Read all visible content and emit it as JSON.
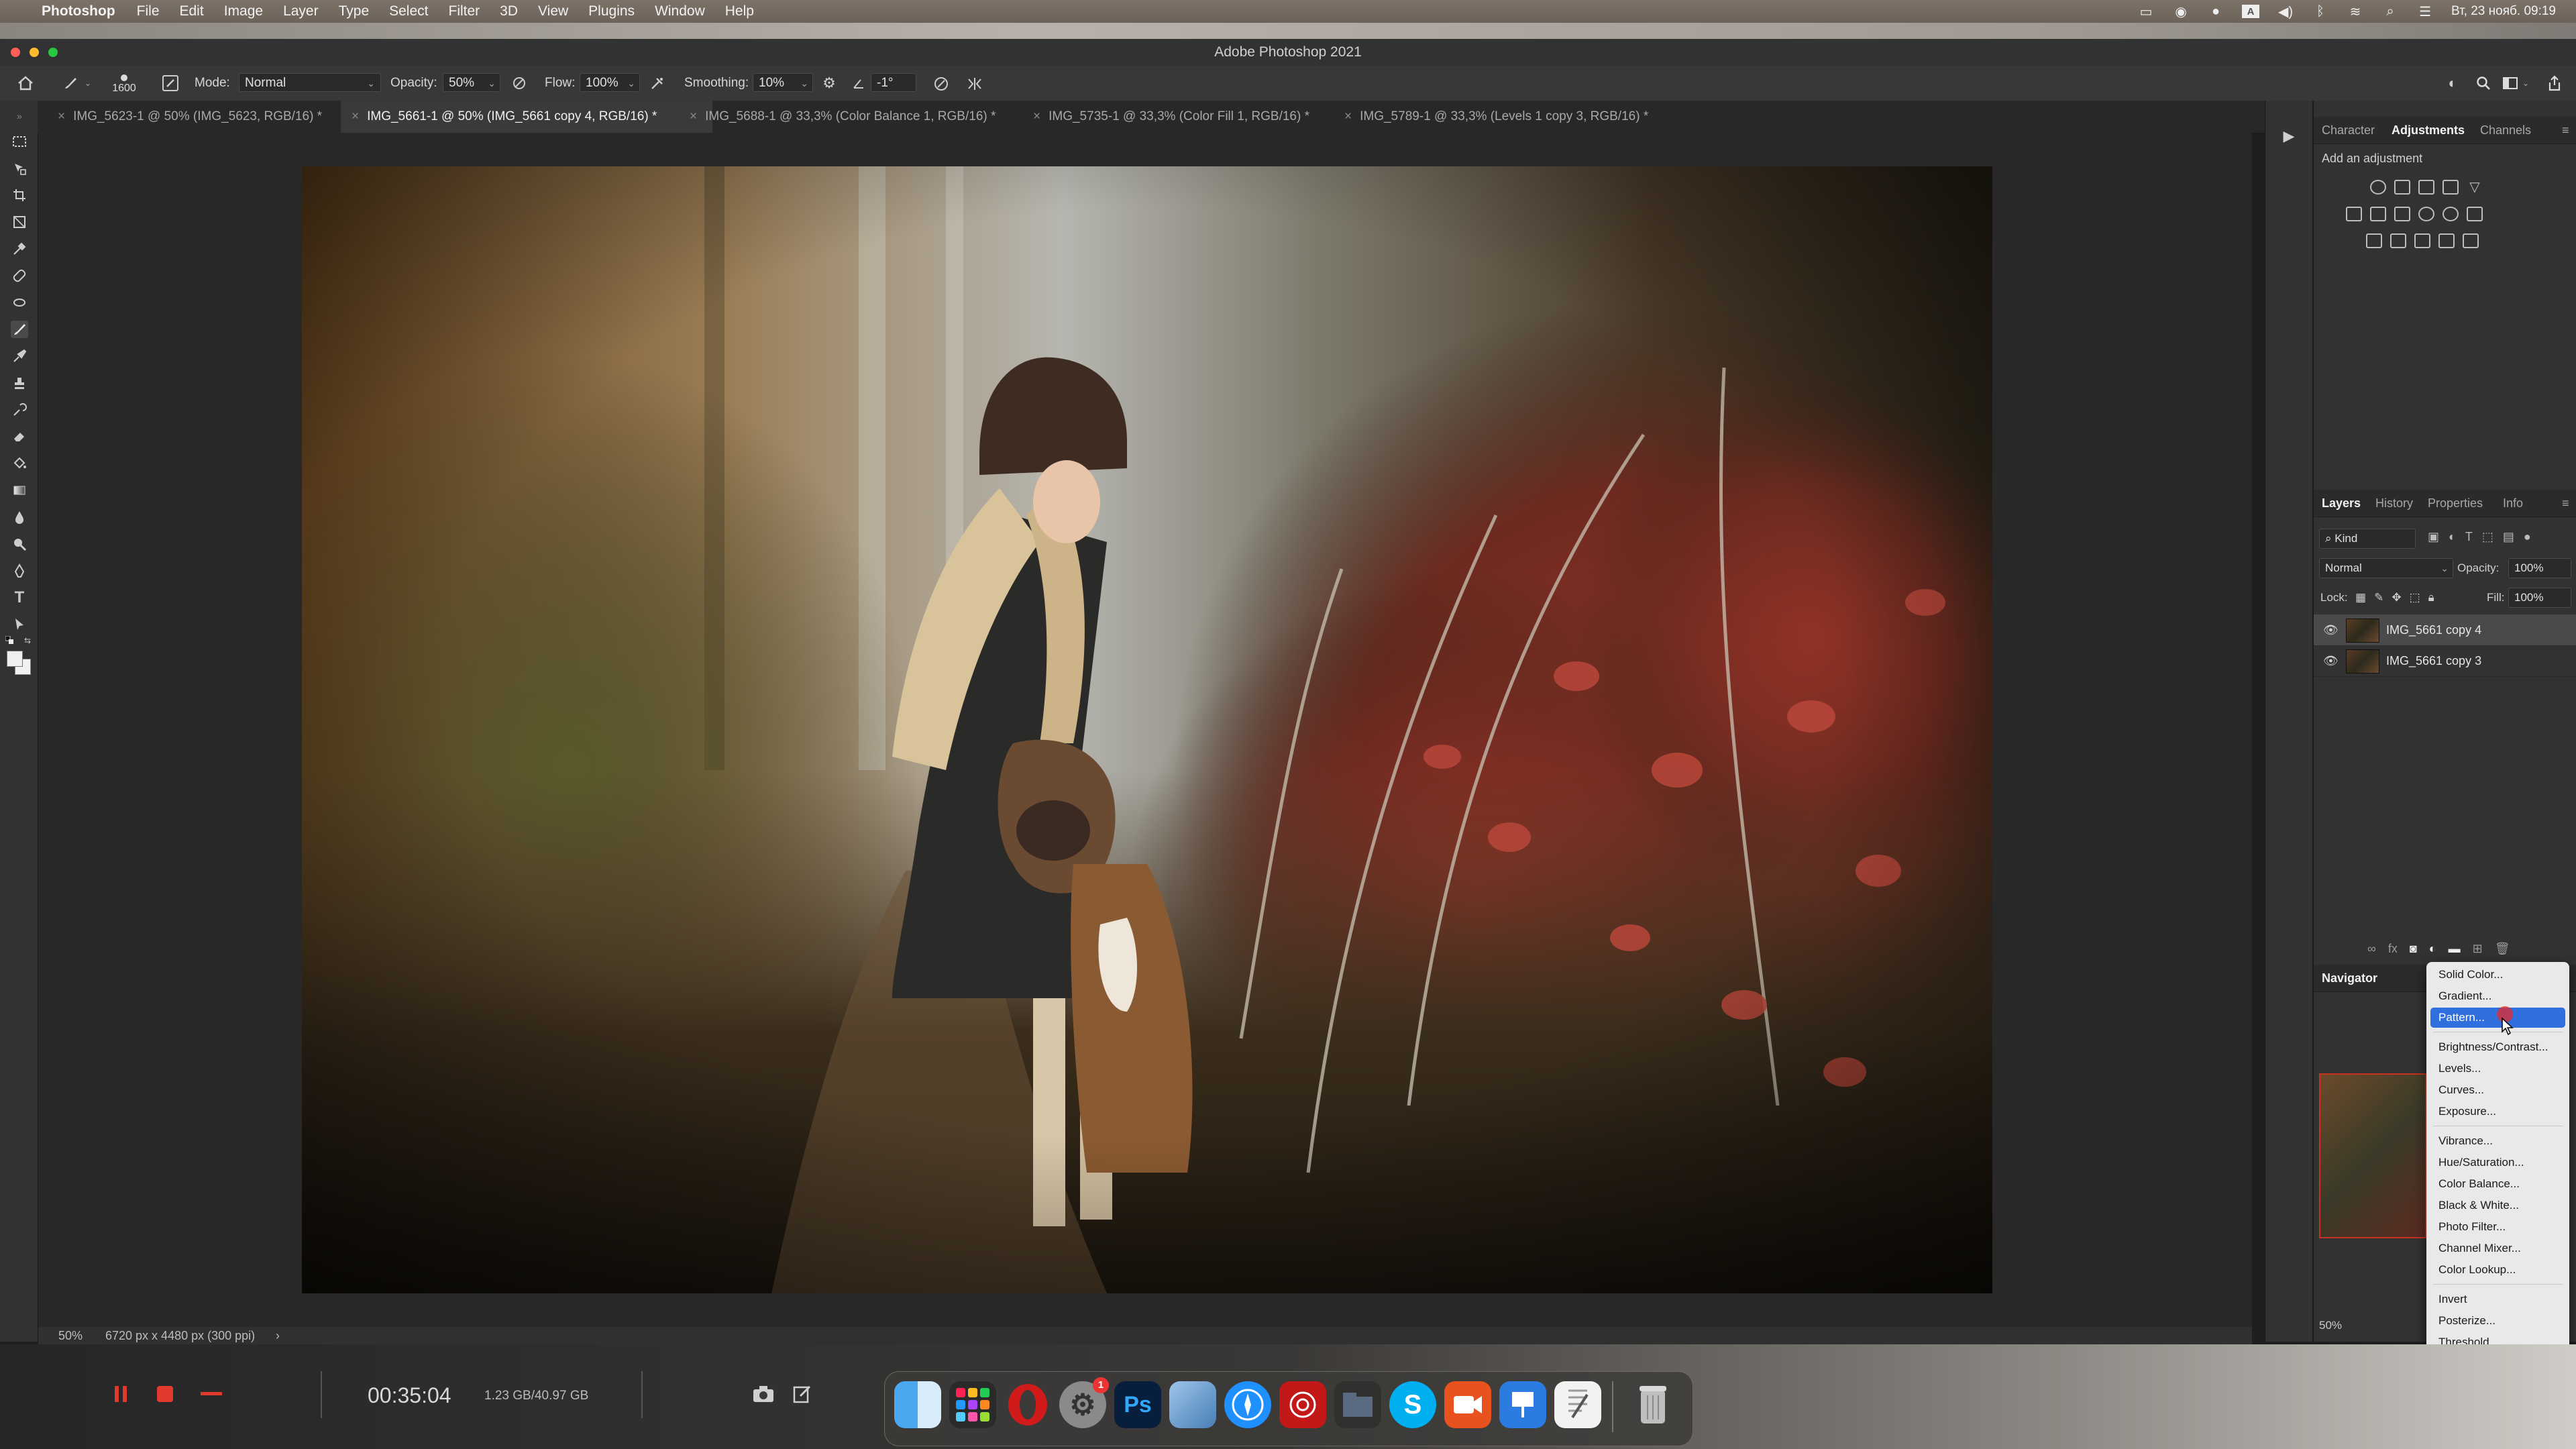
{
  "menubar": {
    "app_name": "Photoshop",
    "items": [
      "File",
      "Edit",
      "Image",
      "Layer",
      "Type",
      "Select",
      "Filter",
      "3D",
      "View",
      "Plugins",
      "Window",
      "Help"
    ],
    "clock": "Вт, 23 нояб. 09:19"
  },
  "window": {
    "title": "Adobe Photoshop 2021"
  },
  "options": {
    "brush_size": "1600",
    "mode_label": "Mode:",
    "mode_value": "Normal",
    "opacity_label": "Opacity:",
    "opacity_value": "50%",
    "flow_label": "Flow:",
    "flow_value": "100%",
    "smoothing_label": "Smoothing:",
    "smoothing_value": "10%",
    "angle_value": "-1°"
  },
  "tabs": [
    {
      "label": "IMG_5623-1 @ 50% (IMG_5623, RGB/16) *",
      "active": false
    },
    {
      "label": "IMG_5661-1 @ 50% (IMG_5661 copy 4, RGB/16) *",
      "active": true
    },
    {
      "label": "IMG_5688-1 @ 33,3% (Color Balance 1, RGB/16) *",
      "active": false
    },
    {
      "label": "IMG_5735-1 @ 33,3% (Color Fill 1, RGB/16) *",
      "active": false
    },
    {
      "label": "IMG_5789-1 @ 33,3% (Levels 1 copy 3, RGB/16) *",
      "active": false
    }
  ],
  "status": {
    "zoom": "50%",
    "doc_info": "6720 px x 4480 px (300 ppi)",
    "arrow": "›"
  },
  "adjustments_panel": {
    "tabs": [
      "Character",
      "Adjustments",
      "Channels"
    ],
    "active_tab": "Adjustments",
    "hint": "Add an adjustment"
  },
  "layers_panel": {
    "tabs": [
      "Layers",
      "History",
      "Properties",
      "Info"
    ],
    "active_tab": "Layers",
    "filter_label": "Kind",
    "blend_mode": "Normal",
    "opacity_label": "Opacity:",
    "opacity_value": "100%",
    "lock_label": "Lock:",
    "fill_label": "Fill:",
    "fill_value": "100%",
    "layers": [
      {
        "name": "IMG_5661 copy 4",
        "visible": true,
        "selected": true
      },
      {
        "name": "IMG_5661 copy 3",
        "visible": true,
        "selected": false
      }
    ]
  },
  "navigator": {
    "title": "Navigator",
    "zoom": "50%"
  },
  "adjustment_menu": {
    "group1": [
      "Solid Color...",
      "Gradient...",
      "Pattern..."
    ],
    "group2": [
      "Brightness/Contrast...",
      "Levels...",
      "Curves...",
      "Exposure..."
    ],
    "group3": [
      "Vibrance...",
      "Hue/Saturation...",
      "Color Balance...",
      "Black & White...",
      "Photo Filter...",
      "Channel Mixer...",
      "Color Lookup..."
    ],
    "group4": [
      "Invert",
      "Posterize...",
      "Threshold..."
    ],
    "selected": "Pattern..."
  },
  "recorder": {
    "time": "00:35:04",
    "storage": "1.23 GB/40.97 GB"
  },
  "dock": {
    "apps": [
      "finder-icon",
      "launchpad-icon",
      "opera-icon",
      "system-preferences-icon",
      "photoshop-icon",
      "preview-icon",
      "safari-icon",
      "camera-raw-icon",
      "file-manager-icon",
      "skype-icon",
      "screen-recorder-icon",
      "keynote-icon",
      "textedit-icon",
      "trash-icon"
    ],
    "ps_label": "Ps",
    "skype_label": "S",
    "notification_badge": "1"
  },
  "colors": {
    "selection_blue": "#2f6fde",
    "panel_bg": "#323232",
    "canvas_bg": "#282828"
  }
}
